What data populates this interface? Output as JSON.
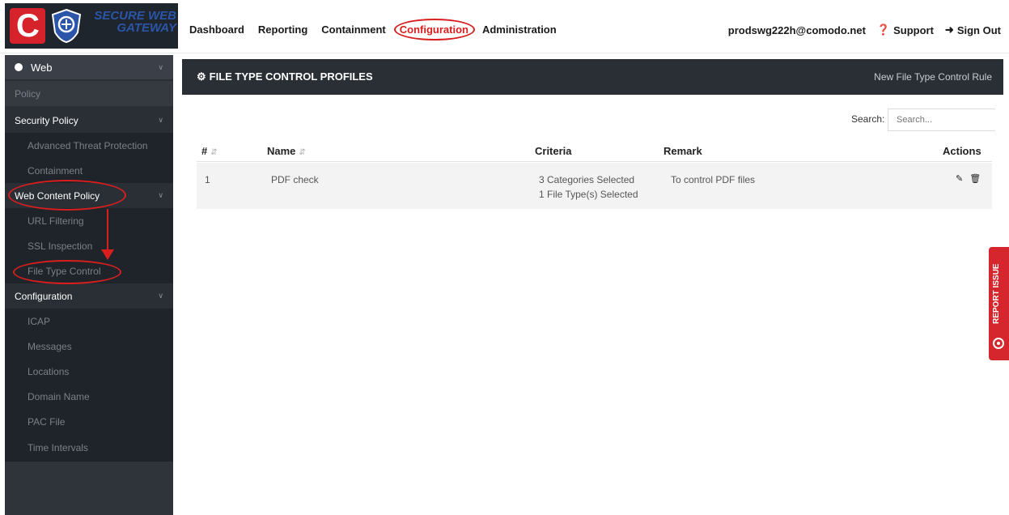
{
  "logo": {
    "mark": "C",
    "line1": "SECURE WEB",
    "line2": "GATEWAY"
  },
  "nav": {
    "items": [
      "Dashboard",
      "Reporting",
      "Containment",
      "Configuration",
      "Administration"
    ],
    "active": "Configuration"
  },
  "user": {
    "email": "prodswg222h@comodo.net",
    "support": "Support",
    "signout": "Sign Out"
  },
  "sidebar": {
    "web": "Web",
    "policy": "Policy",
    "sections": [
      {
        "label": "Security Policy",
        "items": [
          "Advanced Threat Protection",
          "Containment"
        ]
      },
      {
        "label": "Web Content Policy",
        "items": [
          "URL Filtering",
          "SSL Inspection",
          "File Type Control"
        ]
      },
      {
        "label": "Configuration",
        "items": [
          "ICAP",
          "Messages",
          "Locations",
          "Domain Name",
          "PAC File",
          "Time Intervals"
        ]
      }
    ]
  },
  "panel": {
    "title": "FILE TYPE CONTROL PROFILES",
    "new_rule": "New File Type Control Rule",
    "search_label": "Search:",
    "search_placeholder": "Search..."
  },
  "table": {
    "columns": [
      "#",
      "Name",
      "Criteria",
      "Remark",
      "Actions"
    ],
    "rows": [
      {
        "num": "1",
        "name": "PDF check",
        "criteria1": "3 Categories Selected",
        "criteria2": "1 File Type(s) Selected",
        "remark": "To control PDF files"
      }
    ]
  },
  "report_issue": "REPORT ISSUE",
  "colors": {
    "accent": "#d6222a",
    "sidebar": "#2a2f36",
    "header": "#2a2f36",
    "annotation": "#d81e1e"
  }
}
